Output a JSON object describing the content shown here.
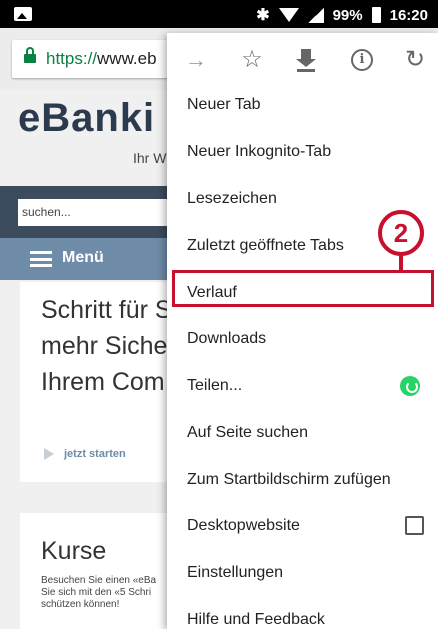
{
  "status_bar": {
    "battery": "99%",
    "time": "16:20"
  },
  "browser": {
    "url_scheme": "https://",
    "url_rest": "www.eb"
  },
  "page": {
    "logo": "eBanki",
    "logo_sub": "Ihr W",
    "search_placeholder": "suchen...",
    "menu_label": "Menü",
    "card1": {
      "heading_lines": [
        "Schritt für S",
        "mehr Siche",
        "Ihrem Com"
      ],
      "cta": "jetzt starten"
    },
    "card2": {
      "heading": "Kurse",
      "text_lines": [
        "Besuchen Sie einen «eBa",
        "Sie sich mit den «5 Schri",
        "schützen können!"
      ]
    }
  },
  "menu": {
    "icons": [
      "forward-icon",
      "star-icon",
      "download-icon",
      "info-icon",
      "reload-icon"
    ],
    "items": [
      {
        "label": "Neuer Tab"
      },
      {
        "label": "Neuer Inkognito-Tab"
      },
      {
        "label": "Lesezeichen"
      },
      {
        "label": "Zuletzt geöffnete Tabs"
      },
      {
        "label": "Verlauf"
      },
      {
        "label": "Downloads"
      },
      {
        "label": "Teilen..."
      },
      {
        "label": "Auf Seite suchen"
      },
      {
        "label": "Zum Startbildschirm zufügen"
      },
      {
        "label": "Desktopwebsite"
      },
      {
        "label": "Einstellungen"
      },
      {
        "label": "Hilfe und Feedback"
      }
    ]
  },
  "annotation": {
    "step": "2",
    "color": "#c8102e"
  }
}
